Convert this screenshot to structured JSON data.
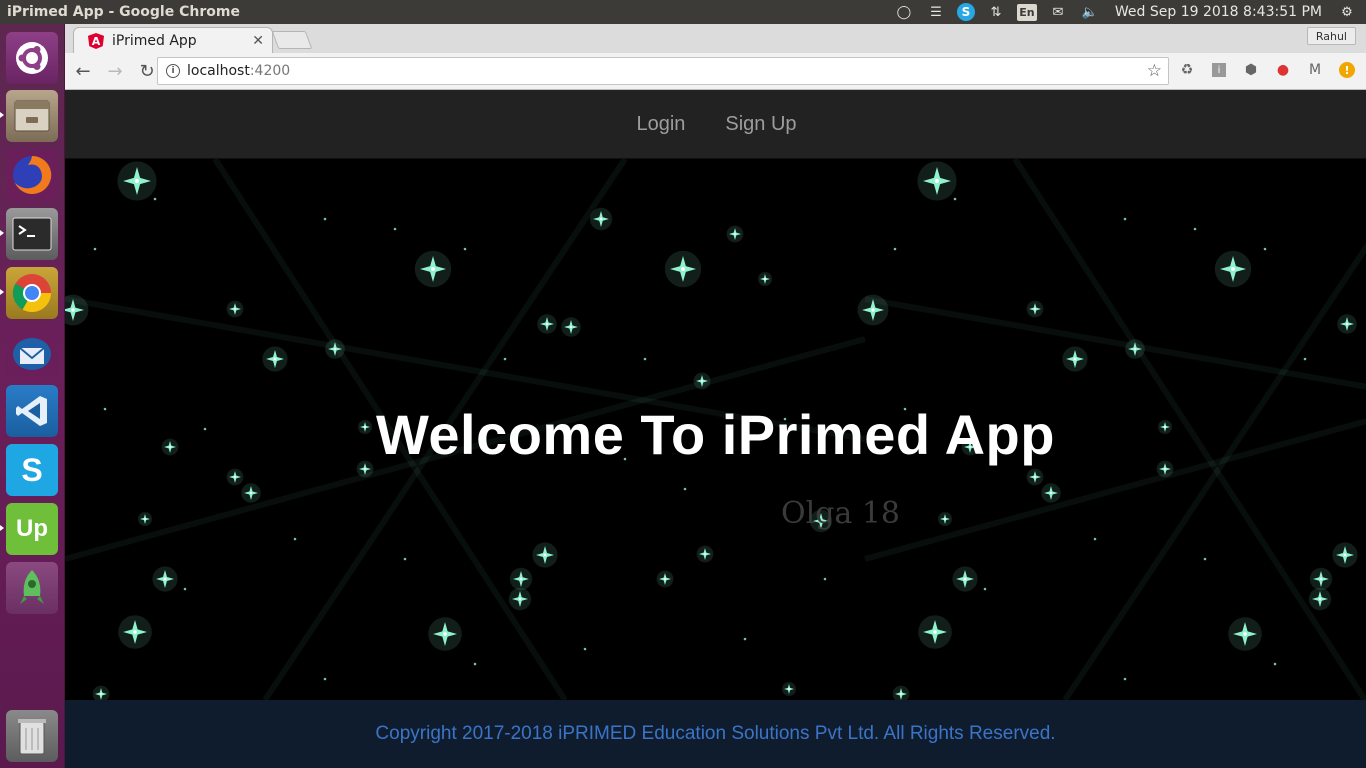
{
  "top_panel": {
    "window_title": "iPrimed App - Google Chrome",
    "keyboard_layout": "En",
    "clock": "Wed Sep 19 2018  8:43:51 PM",
    "icons": [
      "bulb-icon",
      "list-icon",
      "skype-icon",
      "network-icon",
      "keyboard-icon",
      "mail-icon",
      "volume-icon",
      "gear-icon"
    ]
  },
  "launcher": {
    "apps": [
      "ubuntu-icon",
      "files-icon",
      "firefox-icon",
      "terminal-icon",
      "chrome-icon",
      "thunderbird-icon",
      "vscode-icon",
      "skype-icon",
      "upwork-icon",
      "rocket-icon",
      "trash-icon"
    ]
  },
  "browser": {
    "tab_title": "iPrimed App",
    "profile_name": "Rahul",
    "url_host": "localhost",
    "url_port": ":4200"
  },
  "navbar": {
    "login": "Login",
    "signup": "Sign Up"
  },
  "hero": {
    "title": "Welcome To iPrimed App",
    "watermark": "Olga 18"
  },
  "footer": {
    "copyright": "Copyright 2017-2018 iPRIMED Education Solutions Pvt Ltd. All Rights Reserved."
  },
  "colors": {
    "navbar_bg": "#222222",
    "footer_bg": "#0f1c2e",
    "footer_text": "#3b74c7",
    "star": "#8ff3cf"
  }
}
